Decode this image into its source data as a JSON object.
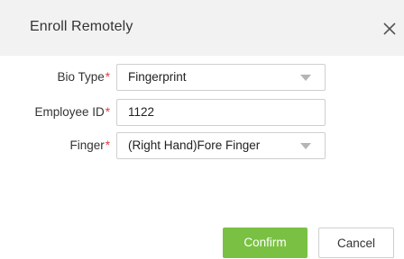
{
  "dialog": {
    "title": "Enroll Remotely"
  },
  "form": {
    "bio_type": {
      "label": "Bio Type",
      "required_mark": "*",
      "value": "Fingerprint"
    },
    "employee_id": {
      "label": "Employee ID",
      "required_mark": "*",
      "value": "1122"
    },
    "finger": {
      "label": "Finger",
      "required_mark": "*",
      "value": "(Right Hand)Fore Finger"
    }
  },
  "buttons": {
    "confirm_label": "Confirm",
    "cancel_label": "Cancel"
  },
  "colors": {
    "header_bg": "#f2f2f2",
    "confirm_bg": "#7ac143",
    "required": "#e33b3b",
    "border": "#cfcfcf"
  },
  "icons": {
    "close": "close-icon",
    "dropdown": "chevron-down-icon"
  }
}
